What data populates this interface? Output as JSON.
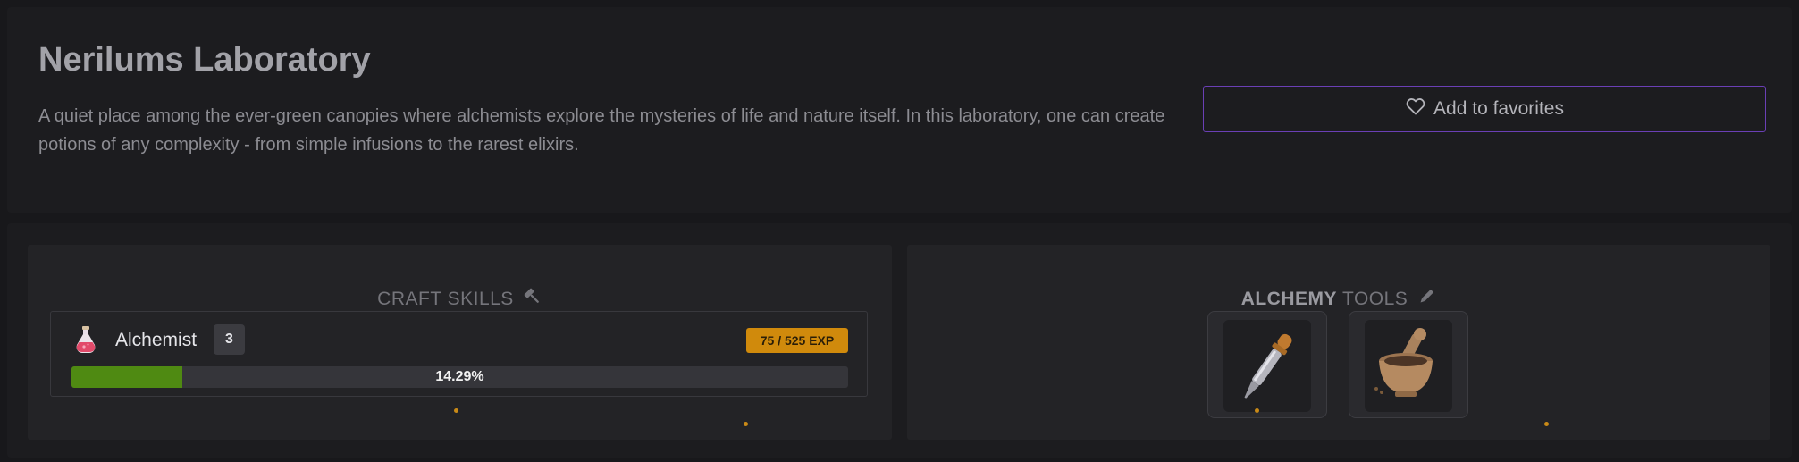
{
  "header": {
    "title": "Nerilums Laboratory",
    "description": "A quiet place among the ever-green canopies where alchemists explore the mysteries of life and nature itself. In this laboratory, one can create potions of any complexity - from simple infusions to the rarest elixirs.",
    "favorite_label": "Add to favorites",
    "favorite_icon": "heart-outline-icon"
  },
  "craft_skills": {
    "title": "CRAFT SKILLS",
    "title_icon": "hammer-icon",
    "skills": [
      {
        "icon": "potion-icon",
        "name": "Alchemist",
        "level": "3",
        "exp_text": "75 / 525 EXP",
        "progress_text": "14.29%",
        "progress": 0.1429
      }
    ]
  },
  "alchemy_tools": {
    "title_strong": "ALCHEMY",
    "title_rest": "TOOLS",
    "title_icon": "pencil-icon",
    "tools": [
      {
        "icon": "pipette-icon"
      },
      {
        "icon": "mortar-and-pestle-icon"
      }
    ]
  },
  "colors": {
    "background": "#18181b",
    "panel": "#232326",
    "accent_border": "#6a3fb5",
    "progress_fill": "#4f8a12",
    "exp_badge": "#d08a0c"
  }
}
